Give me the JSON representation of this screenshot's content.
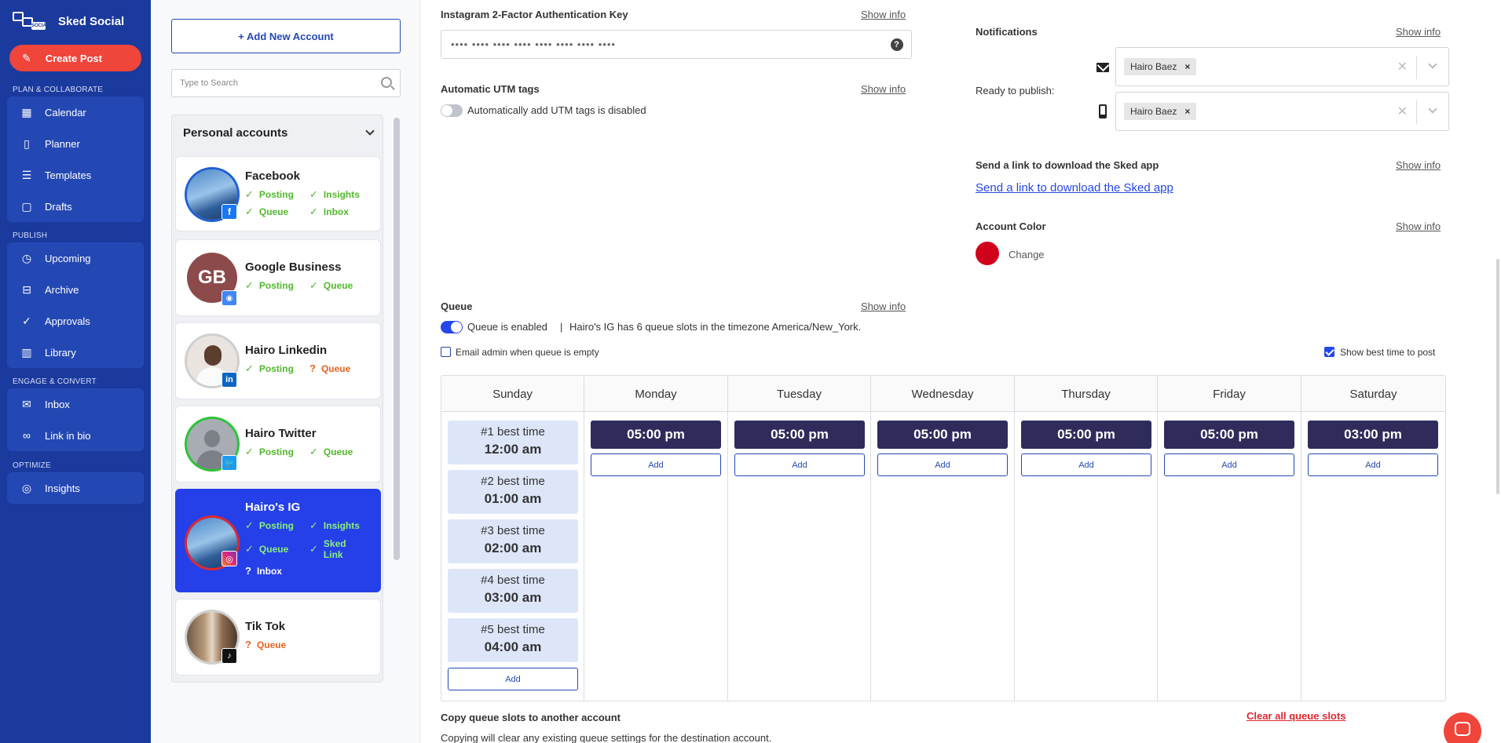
{
  "sidebar": {
    "brand": "Sked Social",
    "brand_logo_text": "SOCIAL",
    "create_post": "Create Post",
    "sections": {
      "plan": "PLAN & COLLABORATE",
      "publish": "PUBLISH",
      "engage": "ENGAGE & CONVERT",
      "optimize": "OPTIMIZE"
    },
    "items": {
      "calendar": "Calendar",
      "planner": "Planner",
      "templates": "Templates",
      "drafts": "Drafts",
      "upcoming": "Upcoming",
      "archive": "Archive",
      "approvals": "Approvals",
      "library": "Library",
      "inbox": "Inbox",
      "link_in_bio": "Link in bio",
      "insights": "Insights"
    },
    "icons": {
      "create_post": "magic-wand-icon",
      "calendar": "calendar-icon",
      "planner": "phone-icon",
      "templates": "templates-icon",
      "drafts": "document-icon",
      "upcoming": "clock-icon",
      "archive": "archive-box-icon",
      "approvals": "check-circle-icon",
      "library": "library-icon",
      "inbox": "envelope-icon",
      "link_in_bio": "link-icon",
      "insights": "insights-icon"
    }
  },
  "accounts": {
    "add_button": "+ Add New Account",
    "search_placeholder": "Type to Search",
    "group_title": "Personal accounts",
    "list": [
      {
        "name": "Facebook",
        "network": "facebook",
        "stats": [
          "Posting",
          "Insights",
          "Queue",
          "Inbox"
        ]
      },
      {
        "name": "Google Business",
        "initials": "GB",
        "network": "google-business",
        "stats": [
          "Posting",
          "Queue"
        ]
      },
      {
        "name": "Hairo Linkedin",
        "network": "linkedin",
        "stats": [
          "Posting",
          "Queue"
        ]
      },
      {
        "name": "Hairo Twitter",
        "network": "twitter",
        "stats": [
          "Posting",
          "Queue"
        ]
      },
      {
        "name": "Hairo's IG",
        "network": "instagram",
        "selected": true,
        "stats": [
          "Posting",
          "Insights",
          "Queue",
          "Sked Link",
          "Inbox"
        ]
      },
      {
        "name": "Tik Tok",
        "network": "tiktok",
        "stats": [
          "Queue"
        ]
      }
    ]
  },
  "settings": {
    "twofa_label": "Instagram 2-Factor Authentication Key",
    "twofa_value": "•••• •••• •••• •••• •••• •••• •••• ••••",
    "utm_label": "Automatic UTM tags",
    "utm_toggle_text": "Automatically add UTM tags is disabled",
    "show_info": "Show info",
    "notifications_label": "Notifications",
    "ready_to_publish": "Ready to publish:",
    "notify_email_user": "Hairo Baez",
    "notify_phone_user": "Hairo Baez",
    "send_link_label": "Send a link to download the Sked app",
    "send_link_text": "Send a link to download the Sked app",
    "account_color_label": "Account Color",
    "account_color_value": "#d0021b",
    "change_label": "Change"
  },
  "queue": {
    "label": "Queue",
    "enabled_text": "Queue is enabled",
    "separator": "|",
    "info_text": "Hairo's IG has 6 queue slots in the timezone America/New_York.",
    "email_admin": "Email admin when queue is empty",
    "show_best_time": "Show best time to post",
    "email_admin_checked": false,
    "show_best_time_checked": true,
    "add_label": "Add",
    "days": [
      {
        "name": "Sunday",
        "best_times": [
          {
            "rank": "#1 best time",
            "time": "12:00 am"
          },
          {
            "rank": "#2 best time",
            "time": "01:00 am"
          },
          {
            "rank": "#3 best time",
            "time": "02:00 am"
          },
          {
            "rank": "#4 best time",
            "time": "03:00 am"
          },
          {
            "rank": "#5 best time",
            "time": "04:00 am"
          }
        ]
      },
      {
        "name": "Monday",
        "slot": "05:00 pm"
      },
      {
        "name": "Tuesday",
        "slot": "05:00 pm"
      },
      {
        "name": "Wednesday",
        "slot": "05:00 pm"
      },
      {
        "name": "Thursday",
        "slot": "05:00 pm"
      },
      {
        "name": "Friday",
        "slot": "05:00 pm"
      },
      {
        "name": "Saturday",
        "slot": "03:00 pm"
      }
    ],
    "copy_title": "Copy queue slots to another account",
    "copy_desc": "Copying will clear any existing queue settings for the destination account.",
    "clear_all": "Clear all queue slots"
  },
  "colors": {
    "sidebar_bg": "#1a3a9e",
    "accent": "#2448e8",
    "create_post": "#f0453a",
    "slot_dark": "#2f2c5c",
    "best_slot": "#dde6f9",
    "danger": "#e0282e"
  }
}
